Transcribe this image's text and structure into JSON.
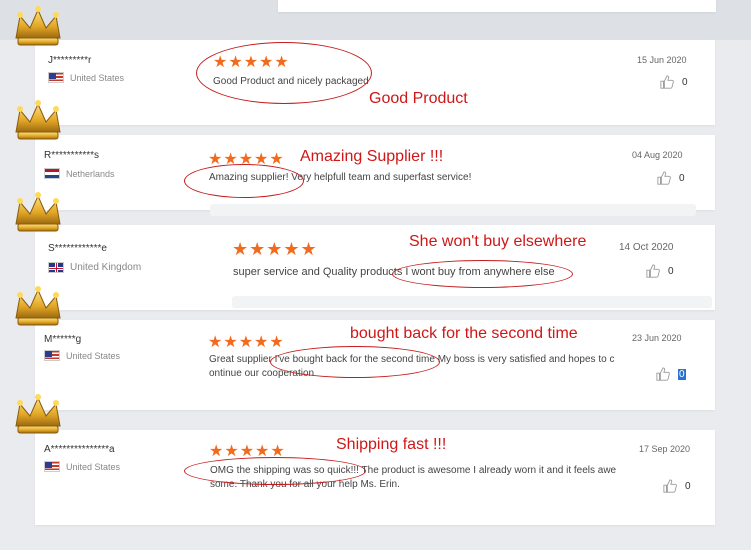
{
  "reviews": [
    {
      "user": "J*********r",
      "country": "United States",
      "flag": "us",
      "stars": "★★★★★",
      "text": "Good Product and nicely packaged",
      "date": "15 Jun 2020",
      "likes": "0",
      "annotation": "Good Product"
    },
    {
      "user": "R***********s",
      "country": "Netherlands",
      "flag": "nl",
      "stars": "★★★★★",
      "text": "Amazing supplier! Very helpfull team and superfast service!",
      "date": "04 Aug 2020",
      "likes": "0",
      "annotation": "Amazing Supplier  !!!"
    },
    {
      "user": "S************e",
      "country": "United Kingdom",
      "flag": "uk",
      "stars": "★★★★★",
      "text": "super service and Quality products I wont buy from anywhere else",
      "date": "14 Oct 2020",
      "likes": "0",
      "annotation": "She won't buy elsewhere"
    },
    {
      "user": "M******g",
      "country": "United States",
      "flag": "us",
      "stars": "★★★★★",
      "text_line1": "Great supplier I've bought back for the second time My boss is very satisfied and hopes to c",
      "text_line2": "ontinue our cooperation",
      "date": "23 Jun 2020",
      "likes": "0",
      "annotation": "bought back for the second time"
    },
    {
      "user": "A***************a",
      "country": "United States",
      "flag": "us",
      "stars": "★★★★★",
      "text_line1": "OMG the shipping was so quick!!! The product is awesome I already worn it and it feels awe",
      "text_line2": "some. Thank you for all your help Ms. Erin.",
      "date": "17 Sep 2020",
      "likes": "0",
      "annotation": "Shipping fast  !!!"
    }
  ],
  "colors": {
    "star": "#f26b1d",
    "annotation": "#d01616",
    "highlight": "#2a73d1"
  },
  "icons": {
    "like": "thumbs-up-icon",
    "crown": "crown-icon"
  }
}
